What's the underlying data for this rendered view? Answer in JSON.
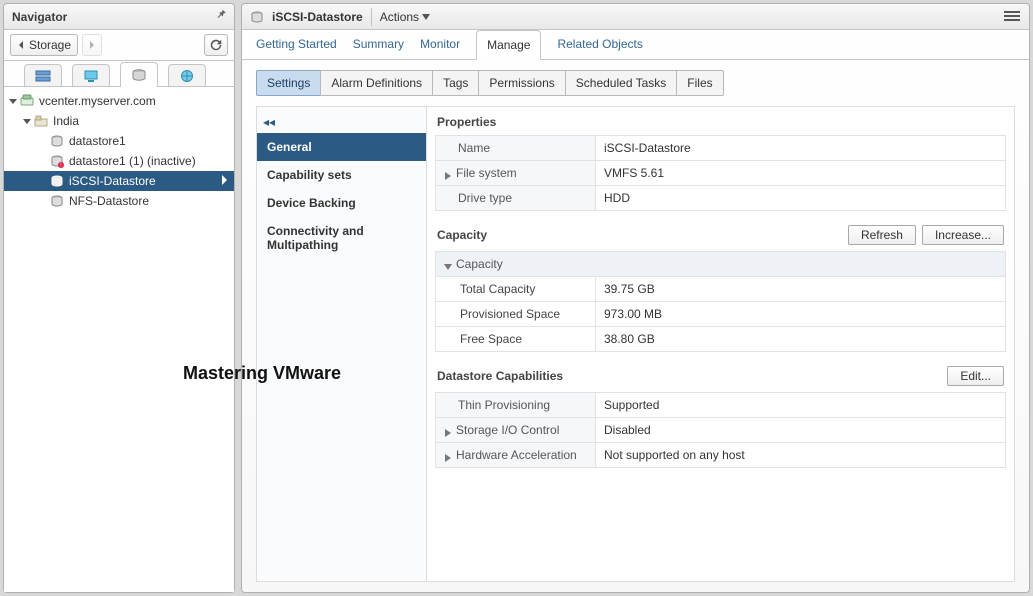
{
  "navigator": {
    "title": "Navigator",
    "breadcrumb": "Storage",
    "tree": {
      "root": "vcenter.myserver.com",
      "datacenter": "India",
      "items": [
        "datastore1",
        "datastore1 (1) (inactive)",
        "iSCSI-Datastore",
        "NFS-Datastore"
      ]
    }
  },
  "watermark": "Mastering VMware",
  "header": {
    "title": "iSCSI-Datastore",
    "actions": "Actions"
  },
  "top_tabs": [
    "Getting Started",
    "Summary",
    "Monitor",
    "Manage",
    "Related Objects"
  ],
  "sub_tabs": [
    "Settings",
    "Alarm Definitions",
    "Tags",
    "Permissions",
    "Scheduled Tasks",
    "Files"
  ],
  "sidemenu": [
    "General",
    "Capability sets",
    "Device Backing",
    "Connectivity and Multipathing"
  ],
  "properties": {
    "title": "Properties",
    "rows": [
      {
        "k": "Name",
        "v": "iSCSI-Datastore"
      },
      {
        "k": "File system",
        "v": "VMFS 5.61",
        "expand": true
      },
      {
        "k": "Drive type",
        "v": "HDD"
      }
    ]
  },
  "capacity": {
    "title": "Capacity",
    "buttons": {
      "refresh": "Refresh",
      "increase": "Increase..."
    },
    "header": "Capacity",
    "rows": [
      {
        "k": "Total Capacity",
        "v": "39.75 GB"
      },
      {
        "k": "Provisioned Space",
        "v": "973.00 MB"
      },
      {
        "k": "Free Space",
        "v": "38.80 GB"
      }
    ]
  },
  "caps": {
    "title": "Datastore Capabilities",
    "edit": "Edit...",
    "rows": [
      {
        "k": "Thin Provisioning",
        "v": "Supported"
      },
      {
        "k": "Storage I/O Control",
        "v": "Disabled",
        "expand": true
      },
      {
        "k": "Hardware Acceleration",
        "v": "Not supported on any host",
        "expand": true
      }
    ]
  }
}
